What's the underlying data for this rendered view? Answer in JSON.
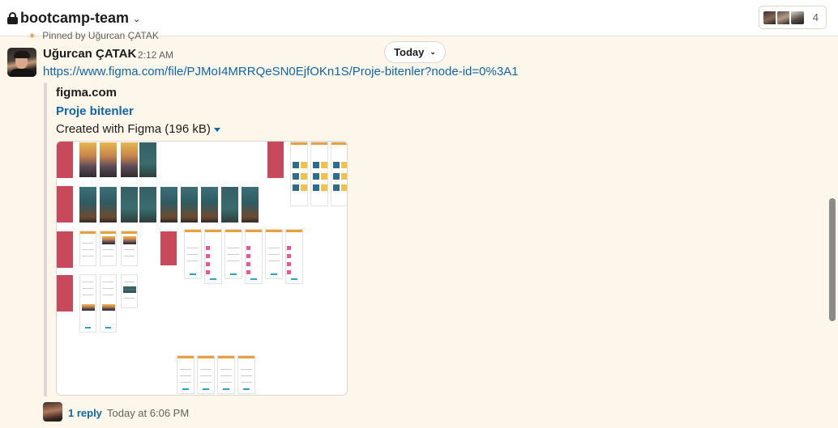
{
  "header": {
    "channel_name": "bootcamp-team",
    "member_count": "4"
  },
  "pinned": {
    "text": "Pinned by Uğurcan ÇATAK"
  },
  "date_divider": {
    "label": "Today"
  },
  "message": {
    "author": "Uğurcan ÇATAK",
    "time": "2:12 AM",
    "link": "https://www.figma.com/file/PJMoI4MRRQeSN0EjfOKn1S/Proje-bitenler?node-id=0%3A1",
    "unfurl": {
      "site": "figma.com",
      "title": "Proje bitenler",
      "meta": "Created with Figma (196 kB)"
    }
  },
  "thread": {
    "replies": "1 reply",
    "last_reply": "Today at 6:06 PM"
  },
  "icons": {
    "lock": "lock-icon",
    "channel_chevron": "chevron-down-icon",
    "pin": "pin-icon",
    "today_chevron": "chevron-down-icon",
    "expand_caret": "caret-down-icon"
  },
  "colors": {
    "background": "#fdf6ea",
    "link": "#1264a3",
    "pin": "#e8912d",
    "figma_section": "#c74a5c"
  }
}
